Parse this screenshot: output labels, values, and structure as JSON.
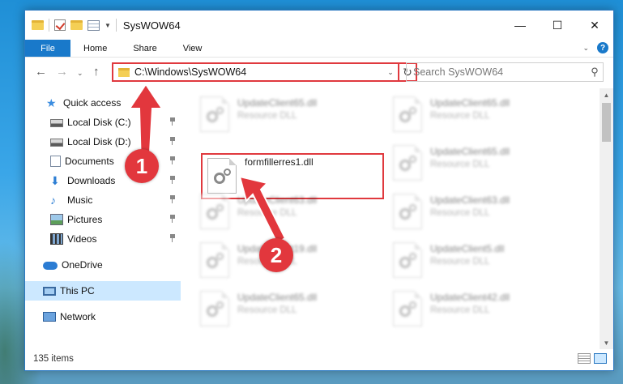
{
  "window": {
    "title": "SysWOW64"
  },
  "ribbon": {
    "tabs": [
      "File",
      "Home",
      "Share",
      "View"
    ],
    "help_label": "?"
  },
  "nav": {
    "address": "C:\\Windows\\SysWOW64",
    "search_placeholder": "Search SysWOW64"
  },
  "sidebar": {
    "items": [
      {
        "label": "Quick access",
        "icon": "star-icon",
        "pinned": false
      },
      {
        "label": "Local Disk (C:)",
        "icon": "drive-icon",
        "pinned": true
      },
      {
        "label": "Local Disk (D:)",
        "icon": "drive-icon",
        "pinned": true
      },
      {
        "label": "Documents",
        "icon": "documents-icon",
        "pinned": true
      },
      {
        "label": "Downloads",
        "icon": "download-icon",
        "pinned": true
      },
      {
        "label": "Music",
        "icon": "music-icon",
        "pinned": true
      },
      {
        "label": "Pictures",
        "icon": "pictures-icon",
        "pinned": true
      },
      {
        "label": "Videos",
        "icon": "videos-icon",
        "pinned": true
      },
      {
        "label": "OneDrive",
        "icon": "cloud-icon",
        "pinned": false
      },
      {
        "label": "This PC",
        "icon": "computer-icon",
        "pinned": false,
        "selected": true
      },
      {
        "label": "Network",
        "icon": "network-icon",
        "pinned": false
      }
    ]
  },
  "files": {
    "left": [
      {
        "name": "UpdateClient65.dll",
        "type": "Resource DLL"
      },
      {
        "name": "formfillerres1.dll",
        "type": ""
      },
      {
        "name": "UpdateClient63.dll",
        "type": "Resource DLL"
      },
      {
        "name": "UpdateClient19.dll",
        "type": "Resource DLL"
      },
      {
        "name": "UpdateClient65.dll",
        "type": "Resource DLL"
      }
    ],
    "right": [
      {
        "name": "UpdateClient65.dll",
        "type": "Resource DLL"
      },
      {
        "name": "UpdateClient65.dll",
        "type": "Resource DLL"
      },
      {
        "name": "UpdateClient63.dll",
        "type": "Resource DLL"
      },
      {
        "name": "UpdateClient5.dll",
        "type": "Resource DLL"
      },
      {
        "name": "UpdateClient42.dll",
        "type": "Resource DLL"
      }
    ]
  },
  "status": {
    "item_count": "135 items"
  },
  "annotations": {
    "step1": "1",
    "step2": "2",
    "color": "#e2373d"
  }
}
